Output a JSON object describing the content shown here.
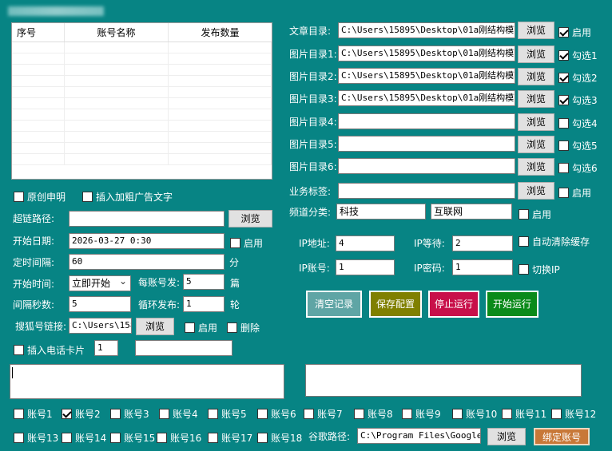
{
  "window": {
    "title_blurred": ""
  },
  "table": {
    "headers": [
      "序号",
      "账号名称",
      "发布数量"
    ]
  },
  "left": {
    "original_label": "原创申明",
    "insert_ad_label": "插入加粗广告文字",
    "hyperlink_label": "超链路径:",
    "hyperlink_value": "",
    "browse": "浏览",
    "start_date_label": "开始日期:",
    "start_date_value": "2026-03-27 0:30",
    "enable": "启用",
    "interval_label": "定时间隔:",
    "interval_value": "60",
    "interval_unit": "分",
    "start_time_label": "开始时间:",
    "start_time_value": "立即开始",
    "per_account_label": "每账号发:",
    "per_account_value": "5",
    "per_account_unit": "篇",
    "interval_sec_label": "间隔秒数:",
    "interval_sec_value": "5",
    "loop_label": "循环发布:",
    "loop_value": "1",
    "loop_unit": "轮",
    "sohu_label": "搜狐号链接:",
    "sohu_value": "C:\\Users\\1589",
    "delete_label": "删除",
    "phone_card_label": "插入电话卡片",
    "phone_card_value": "1",
    "phone_card_extra": ""
  },
  "right": {
    "article_dir_label": "文章目录:",
    "article_dir_value": "C:\\Users\\15895\\Desktop\\01a刚结构模\\文",
    "image_dirs": [
      {
        "label": "图片目录1:",
        "value": "C:\\Users\\15895\\Desktop\\01a刚结构模\\",
        "check": "勾选1",
        "checked": true
      },
      {
        "label": "图片目录2:",
        "value": "C:\\Users\\15895\\Desktop\\01a刚结构模\\",
        "check": "勾选2",
        "checked": true
      },
      {
        "label": "图片目录3:",
        "value": "C:\\Users\\15895\\Desktop\\01a刚结构模\\",
        "check": "勾选3",
        "checked": true
      },
      {
        "label": "图片目录4:",
        "value": "",
        "check": "勾选4",
        "checked": false
      },
      {
        "label": "图片目录5:",
        "value": "",
        "check": "勾选5",
        "checked": false
      },
      {
        "label": "图片目录6:",
        "value": "",
        "check": "勾选6",
        "checked": false
      }
    ],
    "business_tag_label": "业务标签:",
    "business_tag_value": "",
    "channel_label": "频道分类:",
    "channel_value1": "科技",
    "channel_value2": "互联网",
    "ip_label": "IP地址:",
    "ip_value": "4",
    "ip_wait_label": "IP等待:",
    "ip_wait_value": "2",
    "auto_clear_label": "自动清除缓存",
    "ip_account_label": "IP账号:",
    "ip_account_value": "1",
    "ip_password_label": "IP密码:",
    "ip_password_value": "1",
    "switch_ip_label": "切换IP",
    "clear_btn": "清空记录",
    "save_btn": "保存配置",
    "stop_btn": "停止运行",
    "start_btn": "开始运行"
  },
  "accounts": [
    "账号1",
    "账号2",
    "账号3",
    "账号4",
    "账号5",
    "账号6",
    "账号7",
    "账号8",
    "账号9",
    "账号10",
    "账号11",
    "账号12",
    "账号13",
    "账号14",
    "账号15",
    "账号16",
    "账号17",
    "账号18"
  ],
  "chrome_label": "谷歌路径:",
  "chrome_value": "C:\\Program Files\\Google\\C",
  "bind_btn": "绑定账号",
  "colors": {
    "bg": "#078484",
    "clear": "#5fa5a5",
    "save": "#808000",
    "stop": "#c8104a",
    "start": "#0a8a1a",
    "bind": "#c87838"
  }
}
